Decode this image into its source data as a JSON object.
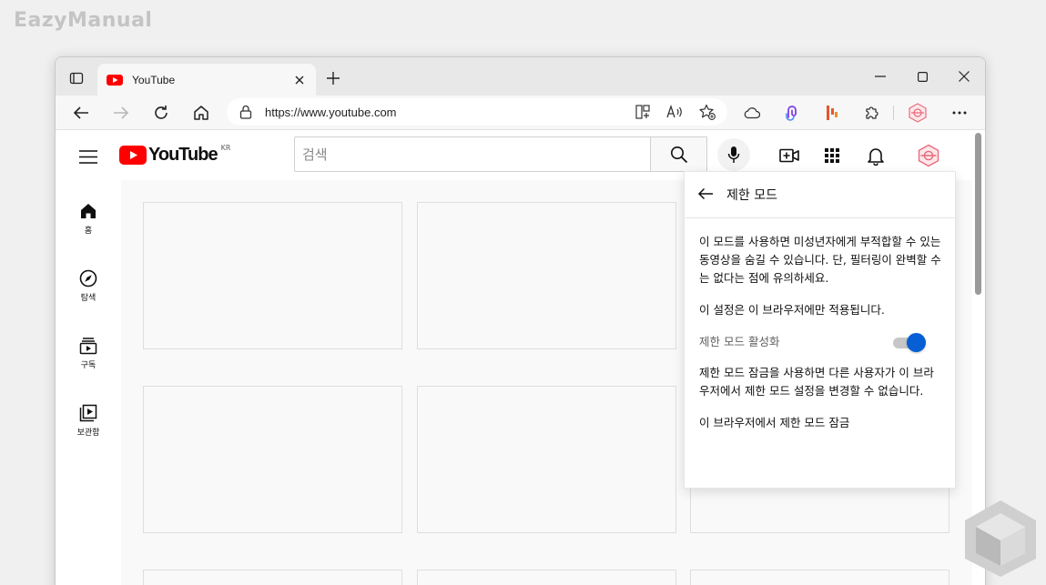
{
  "watermark": "EazyManual",
  "browser": {
    "tab_title": "YouTube",
    "url": "https://www.youtube.com"
  },
  "youtube": {
    "logo_text": "YouTube",
    "country_code": "KR",
    "search_placeholder": "검색",
    "sidebar": [
      {
        "label": "홈",
        "icon": "home-icon"
      },
      {
        "label": "탐색",
        "icon": "explore-icon"
      },
      {
        "label": "구독",
        "icon": "subscriptions-icon"
      },
      {
        "label": "보관함",
        "icon": "library-icon"
      }
    ]
  },
  "restricted_panel": {
    "title": "제한 모드",
    "description": "이 모드를 사용하면 미성년자에게 부적합할 수 있는 동영상을 숨길 수 있습니다. 단, 필터링이 완벽할 수는 없다는 점에 유의하세요.",
    "browser_only_note": "이 설정은 이 브라우저에만 적용됩니다.",
    "toggle_label": "제한 모드 활성화",
    "toggle_on": true,
    "lock_description": "제한 모드 잠금을 사용하면 다른 사용자가 이 브라우저에서 제한 모드 설정을 변경할 수 없습니다.",
    "lock_link": "이 브라우저에서 제한 모드 잠금"
  },
  "colors": {
    "youtube_red": "#ff0000",
    "toggle_blue": "#065fd4"
  }
}
